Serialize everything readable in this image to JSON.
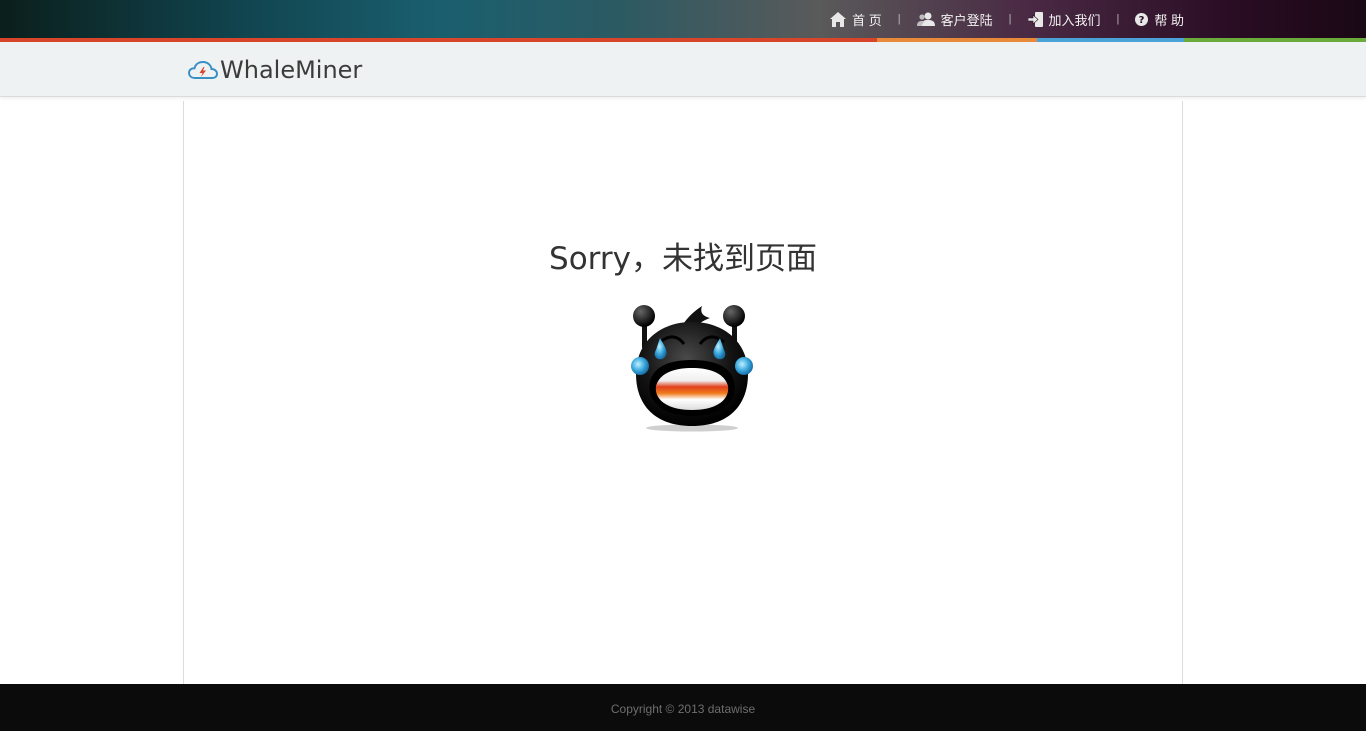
{
  "nav": {
    "items": [
      {
        "label": "首 页",
        "icon": "home-icon"
      },
      {
        "label": "客户登陆",
        "icon": "users-icon"
      },
      {
        "label": "加入我们",
        "icon": "signin-icon"
      },
      {
        "label": "帮 助",
        "icon": "question-circle-icon"
      }
    ],
    "separator": "|"
  },
  "brand": {
    "name": "WhaleMiner",
    "logo_icon": "cloud-lightning-icon"
  },
  "main": {
    "title": "Sorry，未找到页面",
    "illustration": "crying-face-icon"
  },
  "footer": {
    "copyright": "Copyright © 2013 datawise"
  },
  "colors": {
    "strip": [
      "#d9452b",
      "#e8893a",
      "#4aa3d6",
      "#6bab3c"
    ],
    "footer_bg": "#0b0b0b",
    "header_bg": "#eff2f2"
  }
}
